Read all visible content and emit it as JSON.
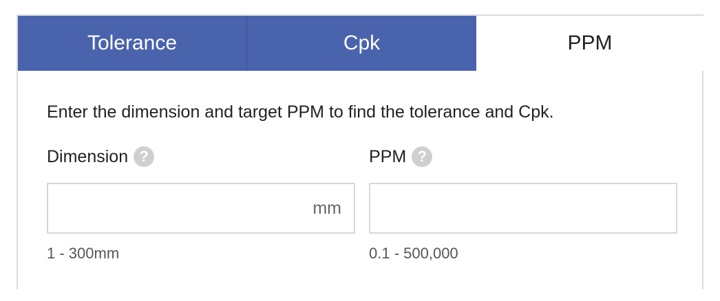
{
  "tabs": [
    {
      "label": "Tolerance",
      "active": false
    },
    {
      "label": "Cpk",
      "active": false
    },
    {
      "label": "PPM",
      "active": true
    }
  ],
  "instructions": "Enter the dimension and target PPM to find the tolerance and Cpk.",
  "dimension": {
    "label": "Dimension",
    "help": "?",
    "value": "",
    "unit": "mm",
    "hint": "1 - 300mm"
  },
  "ppm": {
    "label": "PPM",
    "help": "?",
    "value": "",
    "hint": "0.1 - 500,000"
  },
  "colors": {
    "tab_inactive_bg": "#4a63ad",
    "tab_active_bg": "#ffffff",
    "border": "#dcdcdc",
    "help_icon_bg": "#cfcfcf"
  }
}
